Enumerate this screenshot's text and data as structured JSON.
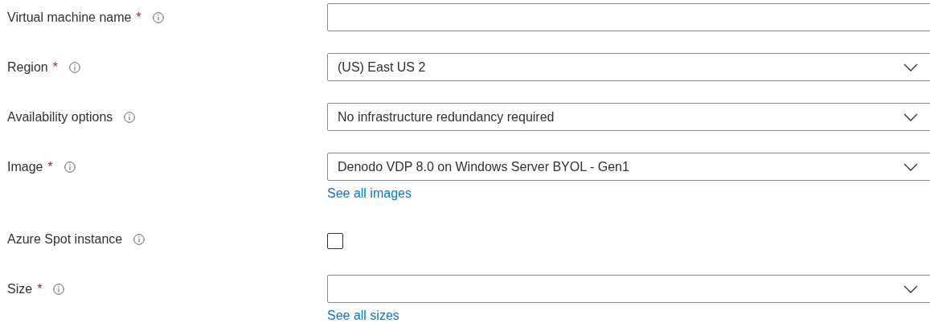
{
  "fields": [
    {
      "kind": "text",
      "label": "Virtual machine name",
      "required_mark": "*"
    },
    {
      "kind": "dropdown",
      "label": "Region",
      "required_mark": "*",
      "value": "(US) East US 2"
    },
    {
      "kind": "dropdown",
      "label": "Availability options",
      "value": "No infrastructure redundancy required"
    },
    {
      "kind": "dropdown",
      "label": "Image",
      "required_mark": "*",
      "value": "Denodo VDP 8.0 on Windows Server BYOL - Gen1",
      "link": "See all images"
    },
    {
      "kind": "checkbox",
      "label": "Azure Spot instance",
      "checked": false
    },
    {
      "kind": "dropdown",
      "label": "Size",
      "required_mark": "*",
      "link": "See all sizes"
    }
  ]
}
